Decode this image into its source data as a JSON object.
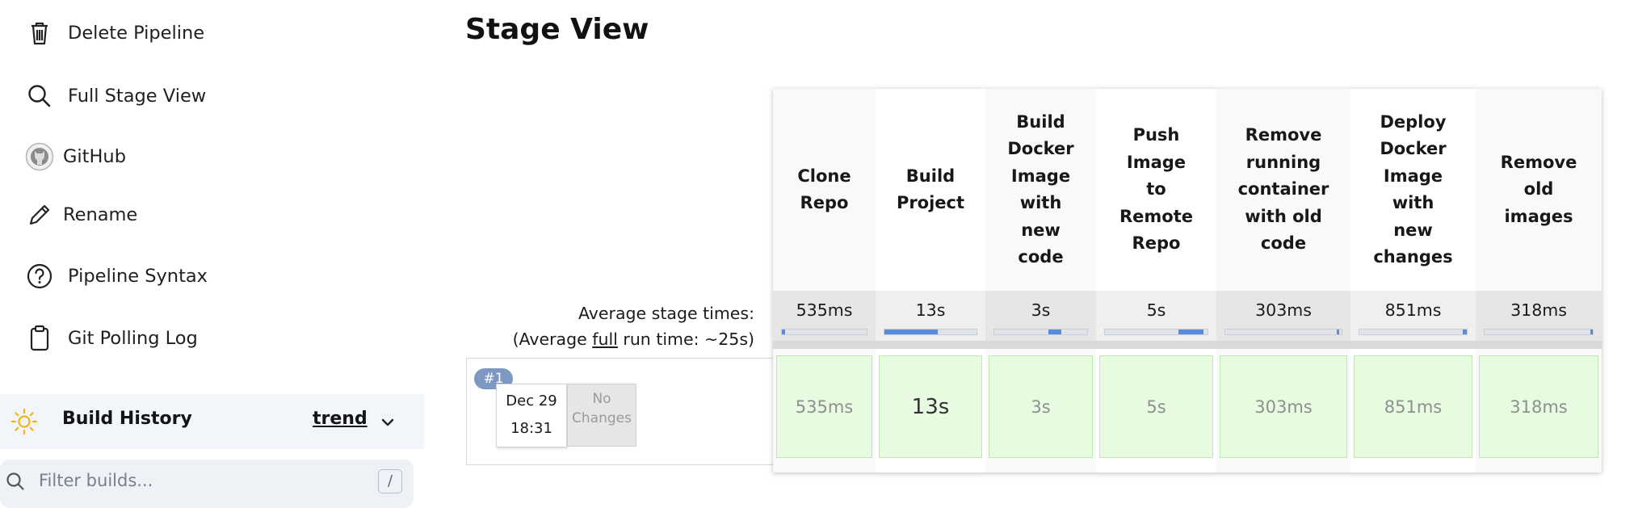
{
  "sidebar": {
    "items": [
      {
        "label": "Delete Pipeline",
        "icon": "trash-icon"
      },
      {
        "label": "Full Stage View",
        "icon": "search-icon"
      },
      {
        "label": "GitHub",
        "icon": "github-icon"
      },
      {
        "label": "Rename",
        "icon": "pencil-icon"
      },
      {
        "label": "Pipeline Syntax",
        "icon": "question-circle-icon"
      },
      {
        "label": "Git Polling Log",
        "icon": "clipboard-icon"
      }
    ]
  },
  "build_history": {
    "title": "Build History",
    "trend_label": "trend",
    "filter_placeholder": "Filter builds...",
    "shortcut": "/"
  },
  "stage_view": {
    "title": "Stage View",
    "avg_stage_label": "Average stage times:",
    "avg_full_prefix": "(Average ",
    "avg_full_word": "full",
    "avg_full_suffix": " run time: ~25s)",
    "stages": [
      {
        "name_lines": [
          "Clone",
          "Repo"
        ],
        "avg": "535ms",
        "bar_fill_start": 0.0,
        "bar_fill_end": 0.04
      },
      {
        "name_lines": [
          "Build",
          "Project"
        ],
        "avg": "13s",
        "bar_fill_start": 0.0,
        "bar_fill_end": 0.58
      },
      {
        "name_lines": [
          "Build",
          "Docker",
          "Image",
          "with",
          "new",
          "code"
        ],
        "avg": "3s",
        "bar_fill_start": 0.58,
        "bar_fill_end": 0.72
      },
      {
        "name_lines": [
          "Push",
          "Image",
          "to",
          "Remote",
          "Repo"
        ],
        "avg": "5s",
        "bar_fill_start": 0.72,
        "bar_fill_end": 0.96
      },
      {
        "name_lines": [
          "Remove",
          "running",
          "container",
          "with old",
          "code"
        ],
        "avg": "303ms",
        "bar_fill_start": 0.96,
        "bar_fill_end": 0.98
      },
      {
        "name_lines": [
          "Deploy",
          "Docker",
          "Image",
          "with",
          "new",
          "changes"
        ],
        "avg": "851ms",
        "bar_fill_start": 0.96,
        "bar_fill_end": 1.0
      },
      {
        "name_lines": [
          "Remove",
          "old",
          "images"
        ],
        "avg": "318ms",
        "bar_fill_start": 0.98,
        "bar_fill_end": 1.0
      }
    ],
    "build": {
      "number": "#1",
      "date": "Dec 29",
      "time": "18:31",
      "changes_line1": "No",
      "changes_line2": "Changes",
      "cells": [
        "535ms",
        "13s",
        "3s",
        "5s",
        "303ms",
        "851ms",
        "318ms"
      ]
    }
  },
  "colors": {
    "success_cell": "#e6fbe0",
    "progress_fill": "#5a8ad8",
    "badge": "#7e98c4"
  }
}
